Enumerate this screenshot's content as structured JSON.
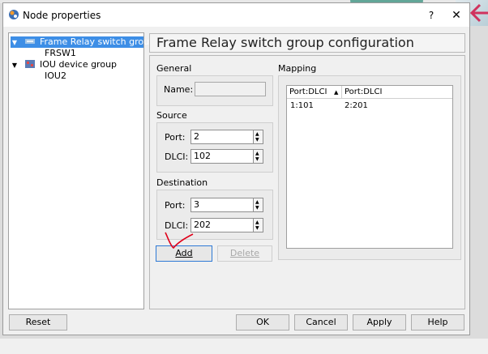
{
  "window": {
    "title": "Node properties",
    "help": "?",
    "close": "✕"
  },
  "tree": {
    "items": [
      {
        "label": "Frame Relay switch group",
        "selected": true,
        "expanded": true
      },
      {
        "label": "FRSW1"
      },
      {
        "label": "IOU device group",
        "expanded": true
      },
      {
        "label": "IOU2"
      }
    ]
  },
  "panel": {
    "header": "Frame Relay switch group configuration"
  },
  "general": {
    "label": "General",
    "name_label": "Name:",
    "name_value": ""
  },
  "source": {
    "label": "Source",
    "port_label": "Port:",
    "port_value": "2",
    "dlci_label": "DLCI:",
    "dlci_value": "102"
  },
  "destination": {
    "label": "Destination",
    "port_label": "Port:",
    "port_value": "3",
    "dlci_label": "DLCI:",
    "dlci_value": "202"
  },
  "actions": {
    "add": "Add",
    "delete": "Delete"
  },
  "mapping": {
    "label": "Mapping",
    "columns": [
      "Port:DLCI",
      "Port:DLCI"
    ],
    "rows": [
      [
        "1:101",
        "2:201"
      ]
    ]
  },
  "footer": {
    "reset": "Reset",
    "ok": "OK",
    "cancel": "Cancel",
    "apply": "Apply",
    "help": "Help"
  },
  "colors": {
    "selection": "#3d8ee6",
    "annotation": "#e0001a"
  }
}
